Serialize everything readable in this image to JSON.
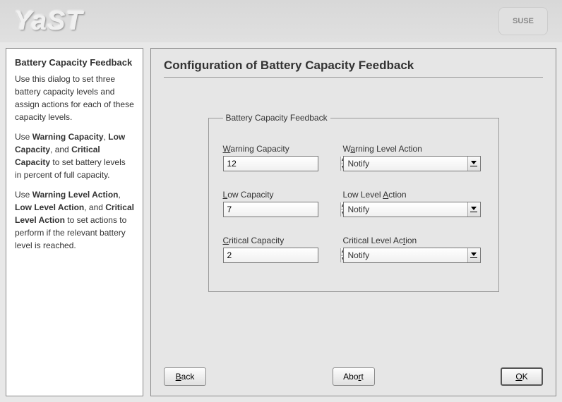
{
  "header": {
    "logo_text": "YaST",
    "brand": "SUSE"
  },
  "sidebar": {
    "title": "Battery Capacity Feedback",
    "intro": "Use this dialog to set three battery capacity levels and assign actions for each of these capacity levels.",
    "p2_pre": "Use ",
    "p2_b1": "Warning Capacity",
    "p2_mid1": ", ",
    "p2_b2": "Low Capacity",
    "p2_mid2": ", and ",
    "p2_b3": "Critical Capacity",
    "p2_post": " to set battery levels in percent of full capacity.",
    "p3_pre": "Use ",
    "p3_b1": "Warning Level Action",
    "p3_mid1": ", ",
    "p3_b2": "Low Level Action",
    "p3_mid2": ", and ",
    "p3_b3": "Critical Level Action",
    "p3_post": " to set actions to perform if the relevant battery level is reached."
  },
  "main": {
    "title": "Configuration of Battery Capacity Feedback",
    "group_legend": "Battery Capacity Feedback",
    "fields": {
      "warning_cap": {
        "label_u": "W",
        "label_rest": "arning Capacity",
        "value": "12"
      },
      "warning_act": {
        "label_pre": "W",
        "label_u": "a",
        "label_rest": "rning Level Action",
        "value": "Notify"
      },
      "low_cap": {
        "label_u": "L",
        "label_rest": "ow Capacity",
        "value": "7"
      },
      "low_act": {
        "label_pre": "Low Level ",
        "label_u": "A",
        "label_rest": "ction",
        "value": "Notify"
      },
      "crit_cap": {
        "label_u": "C",
        "label_rest": "ritical Capacity",
        "value": "2"
      },
      "crit_act": {
        "label_pre": "Critical Level Ac",
        "label_u": "t",
        "label_rest": "ion",
        "value": "Notify"
      }
    }
  },
  "footer": {
    "back_u": "B",
    "back_rest": "ack",
    "abort_pre": "Abo",
    "abort_u": "r",
    "abort_rest": "t",
    "ok_u": "O",
    "ok_rest": "K"
  }
}
